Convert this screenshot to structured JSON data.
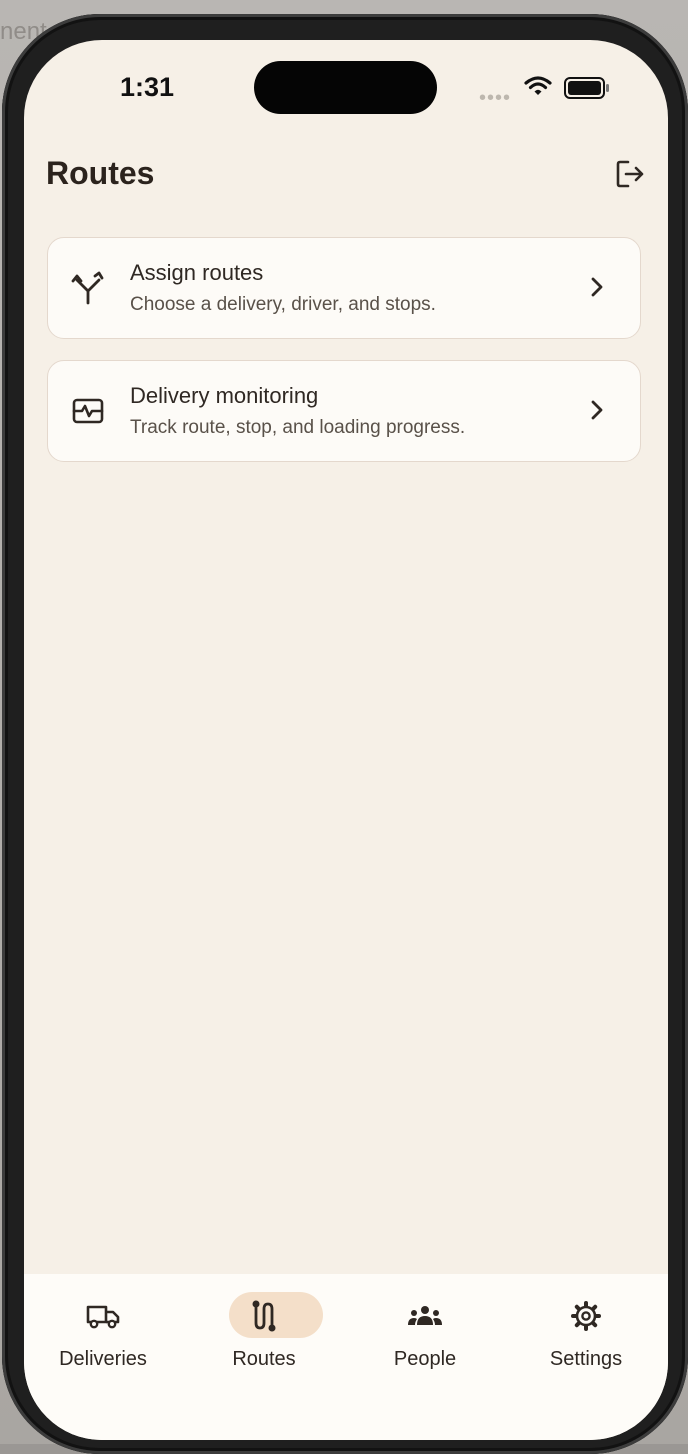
{
  "background": {
    "text": "nent"
  },
  "status_bar": {
    "time": "1:31"
  },
  "header": {
    "title": "Routes",
    "logout_icon": "logout-icon"
  },
  "cards": [
    {
      "title": "Assign routes",
      "subtitle": "Choose a delivery, driver, and stops.",
      "icon": "route-split-icon"
    },
    {
      "title": "Delivery monitoring",
      "subtitle": "Track route, stop, and loading progress.",
      "icon": "monitor-pulse-icon"
    }
  ],
  "tabbar": {
    "tabs": [
      {
        "label": "Deliveries",
        "icon": "truck-icon",
        "active": false
      },
      {
        "label": "Routes",
        "icon": "route-icon",
        "active": true
      },
      {
        "label": "People",
        "icon": "people-icon",
        "active": false
      },
      {
        "label": "Settings",
        "icon": "gear-icon",
        "active": false
      }
    ]
  },
  "colors": {
    "background": "#f6f0e7",
    "card": "#fdfbf7",
    "card_border": "#e4d8cd",
    "accent_pill": "#f4dfc9",
    "text": "#2f2823"
  }
}
